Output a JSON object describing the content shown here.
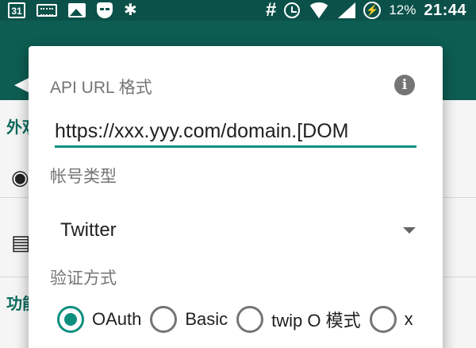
{
  "status_bar": {
    "calendar_day": "31",
    "battery_icon_glyph": "⚡",
    "battery_percent": "12%",
    "time": "21:44",
    "icons": [
      "calendar-icon",
      "keyboard-icon",
      "image-icon",
      "mask-icon",
      "leaf-icon",
      "hash-icon",
      "alarm-icon",
      "wifi-icon",
      "signal-icon",
      "battery-icon"
    ]
  },
  "background": {
    "section_1": "外观",
    "section_2": "功能"
  },
  "dialog": {
    "api_url_label": "API URL 格式",
    "api_url_value": "https://xxx.yyy.com/domain.[DOM",
    "account_type_label": "帐号类型",
    "account_type_value": "Twitter",
    "auth_label": "验证方式",
    "auth_options": [
      {
        "label": "OAuth",
        "checked": true
      },
      {
        "label": "Basic",
        "checked": false
      },
      {
        "label": "twip O 模式",
        "checked": false
      },
      {
        "label": "x",
        "checked": false
      }
    ]
  },
  "colors": {
    "accent": "#0d8f7e",
    "toolbar": "#0d5d52",
    "status_bar": "#0b5149"
  }
}
